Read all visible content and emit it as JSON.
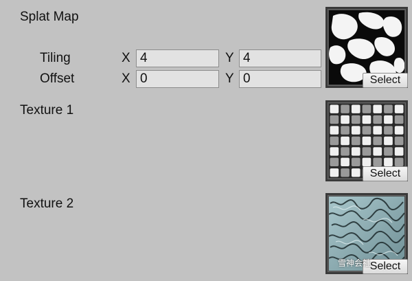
{
  "splat_map": {
    "label": "Splat Map",
    "tiling_label": "Tiling",
    "offset_label": "Offset",
    "x_axis": "X",
    "y_axis": "Y",
    "tiling_x": "4",
    "tiling_y": "4",
    "offset_x": "0",
    "offset_y": "0",
    "select_label": "Select",
    "thumbnail_icon": "splat-map-texture-icon"
  },
  "texture1": {
    "label": "Texture 1",
    "select_label": "Select",
    "thumbnail_icon": "checker-texture-icon"
  },
  "texture2": {
    "label": "Texture 2",
    "select_label": "Select",
    "thumbnail_icon": "rock-texture-icon"
  },
  "watermark": "雪神会社",
  "colors": {
    "panel_bg": "#c2c2c2",
    "field_bg": "#e2e2e2",
    "thumb_border": "#3a3a3a"
  }
}
